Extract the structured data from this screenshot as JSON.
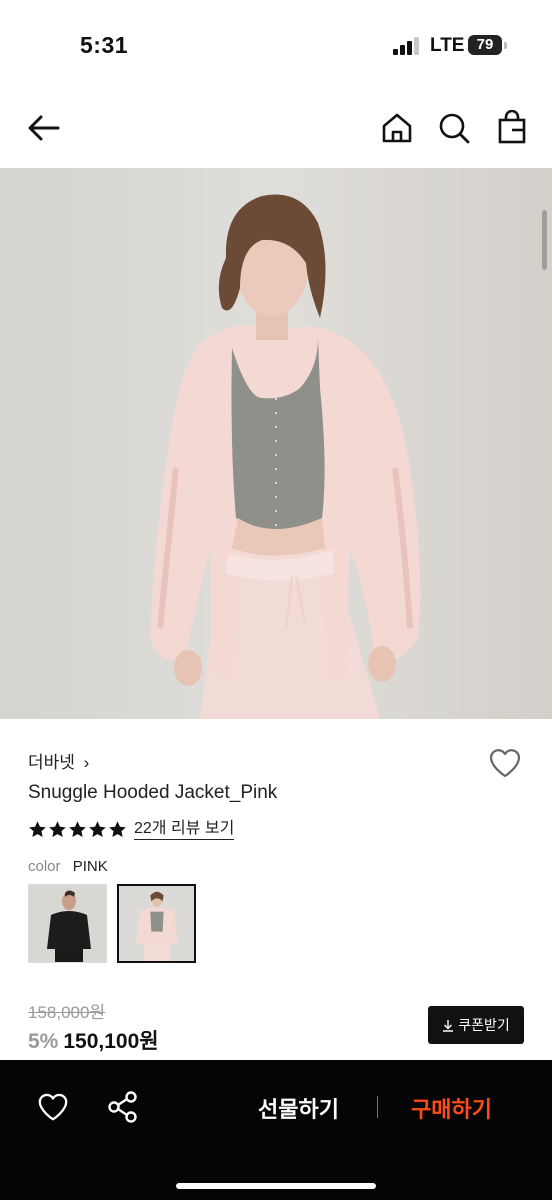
{
  "status_bar": {
    "time": "5:31",
    "network": "LTE",
    "battery": "79"
  },
  "nav": {
    "back_icon": "arrow-left-icon",
    "home_icon": "home-icon",
    "search_icon": "search-icon",
    "bag_icon": "shopping-bag-icon"
  },
  "product": {
    "brand": "더바넷",
    "brand_chevron": "›",
    "name": "Snuggle Hooded Jacket_Pink",
    "rating_stars": 5,
    "review_text": "22개 리뷰 보기",
    "color_label": "color",
    "color_value": "PINK",
    "original_price": "158,000원",
    "discount": "5%",
    "price": "150,100원",
    "coupon_label": "쿠폰받기"
  },
  "bottom_bar": {
    "gift_label": "선물하기",
    "buy_label": "구매하기"
  },
  "colors": {
    "accent": "#ff4a1a",
    "bottom_bar": "#050505",
    "jacket_pink": "#f3d6d2"
  }
}
